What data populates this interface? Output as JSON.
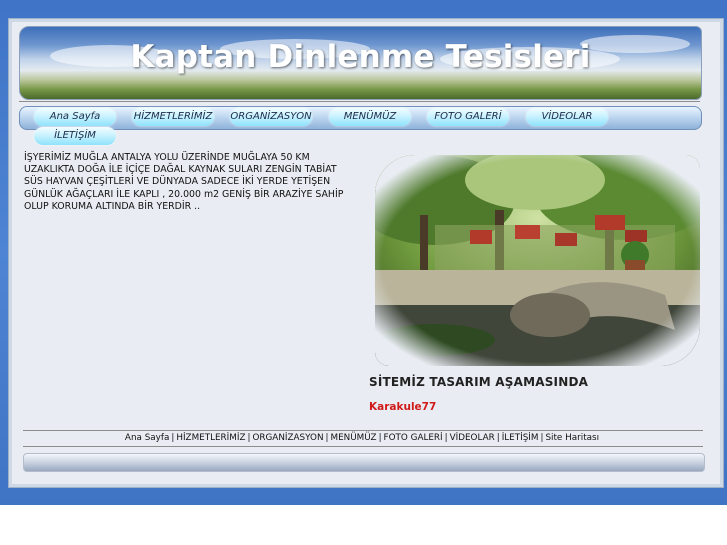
{
  "header": {
    "site_title": "Kaptan Dinlenme Tesisleri"
  },
  "nav": {
    "items": [
      {
        "label": "Ana Sayfa"
      },
      {
        "label": "HİZMETLERİMİZ"
      },
      {
        "label": "ORGANİZASYON"
      },
      {
        "label": "MENÜMÜZ"
      },
      {
        "label": "FOTO GALERİ"
      },
      {
        "label": "VİDEOLAR"
      },
      {
        "label": "İLETİŞİM"
      }
    ]
  },
  "main": {
    "intro_text": "İŞYERİMİZ MUĞLA ANTALYA YOLU ÜZERİNDE MUĞLAYA 50 KM UZAKLIKTA DOĞA İLE İÇİÇE DAĞAL KAYNAK SULARI ZENGİN TABİAT SÜS HAYVAN ÇEŞİTLERİ VE DÜNYADA SADECE İKİ YERDE YETİŞEN GÜNLÜK AĞAÇLARI İLE KAPLI , 20.000 m2 GENİŞ BİR ARAZİYE SAHİP OLUP KORUMA ALTINDA BİR YERDİR ..",
    "status_text": "SİTEMİZ TASARIM AŞAMASINDA",
    "credit_text": "Karakule77"
  },
  "footer": {
    "links": [
      {
        "label": "Ana Sayfa"
      },
      {
        "label": "HİZMETLERİMİZ"
      },
      {
        "label": "ORGANİZASYON"
      },
      {
        "label": "MENÜMÜZ"
      },
      {
        "label": "FOTO GALERİ"
      },
      {
        "label": "VİDEOLAR"
      },
      {
        "label": "İLETİŞİM"
      },
      {
        "label": "Site Haritası"
      }
    ],
    "separator": "|"
  },
  "colors": {
    "page_background": "#4f84d4",
    "frame_background": "#e9edf3",
    "nav_button": "#a6e9fd",
    "credit_red": "#d11a1a"
  }
}
